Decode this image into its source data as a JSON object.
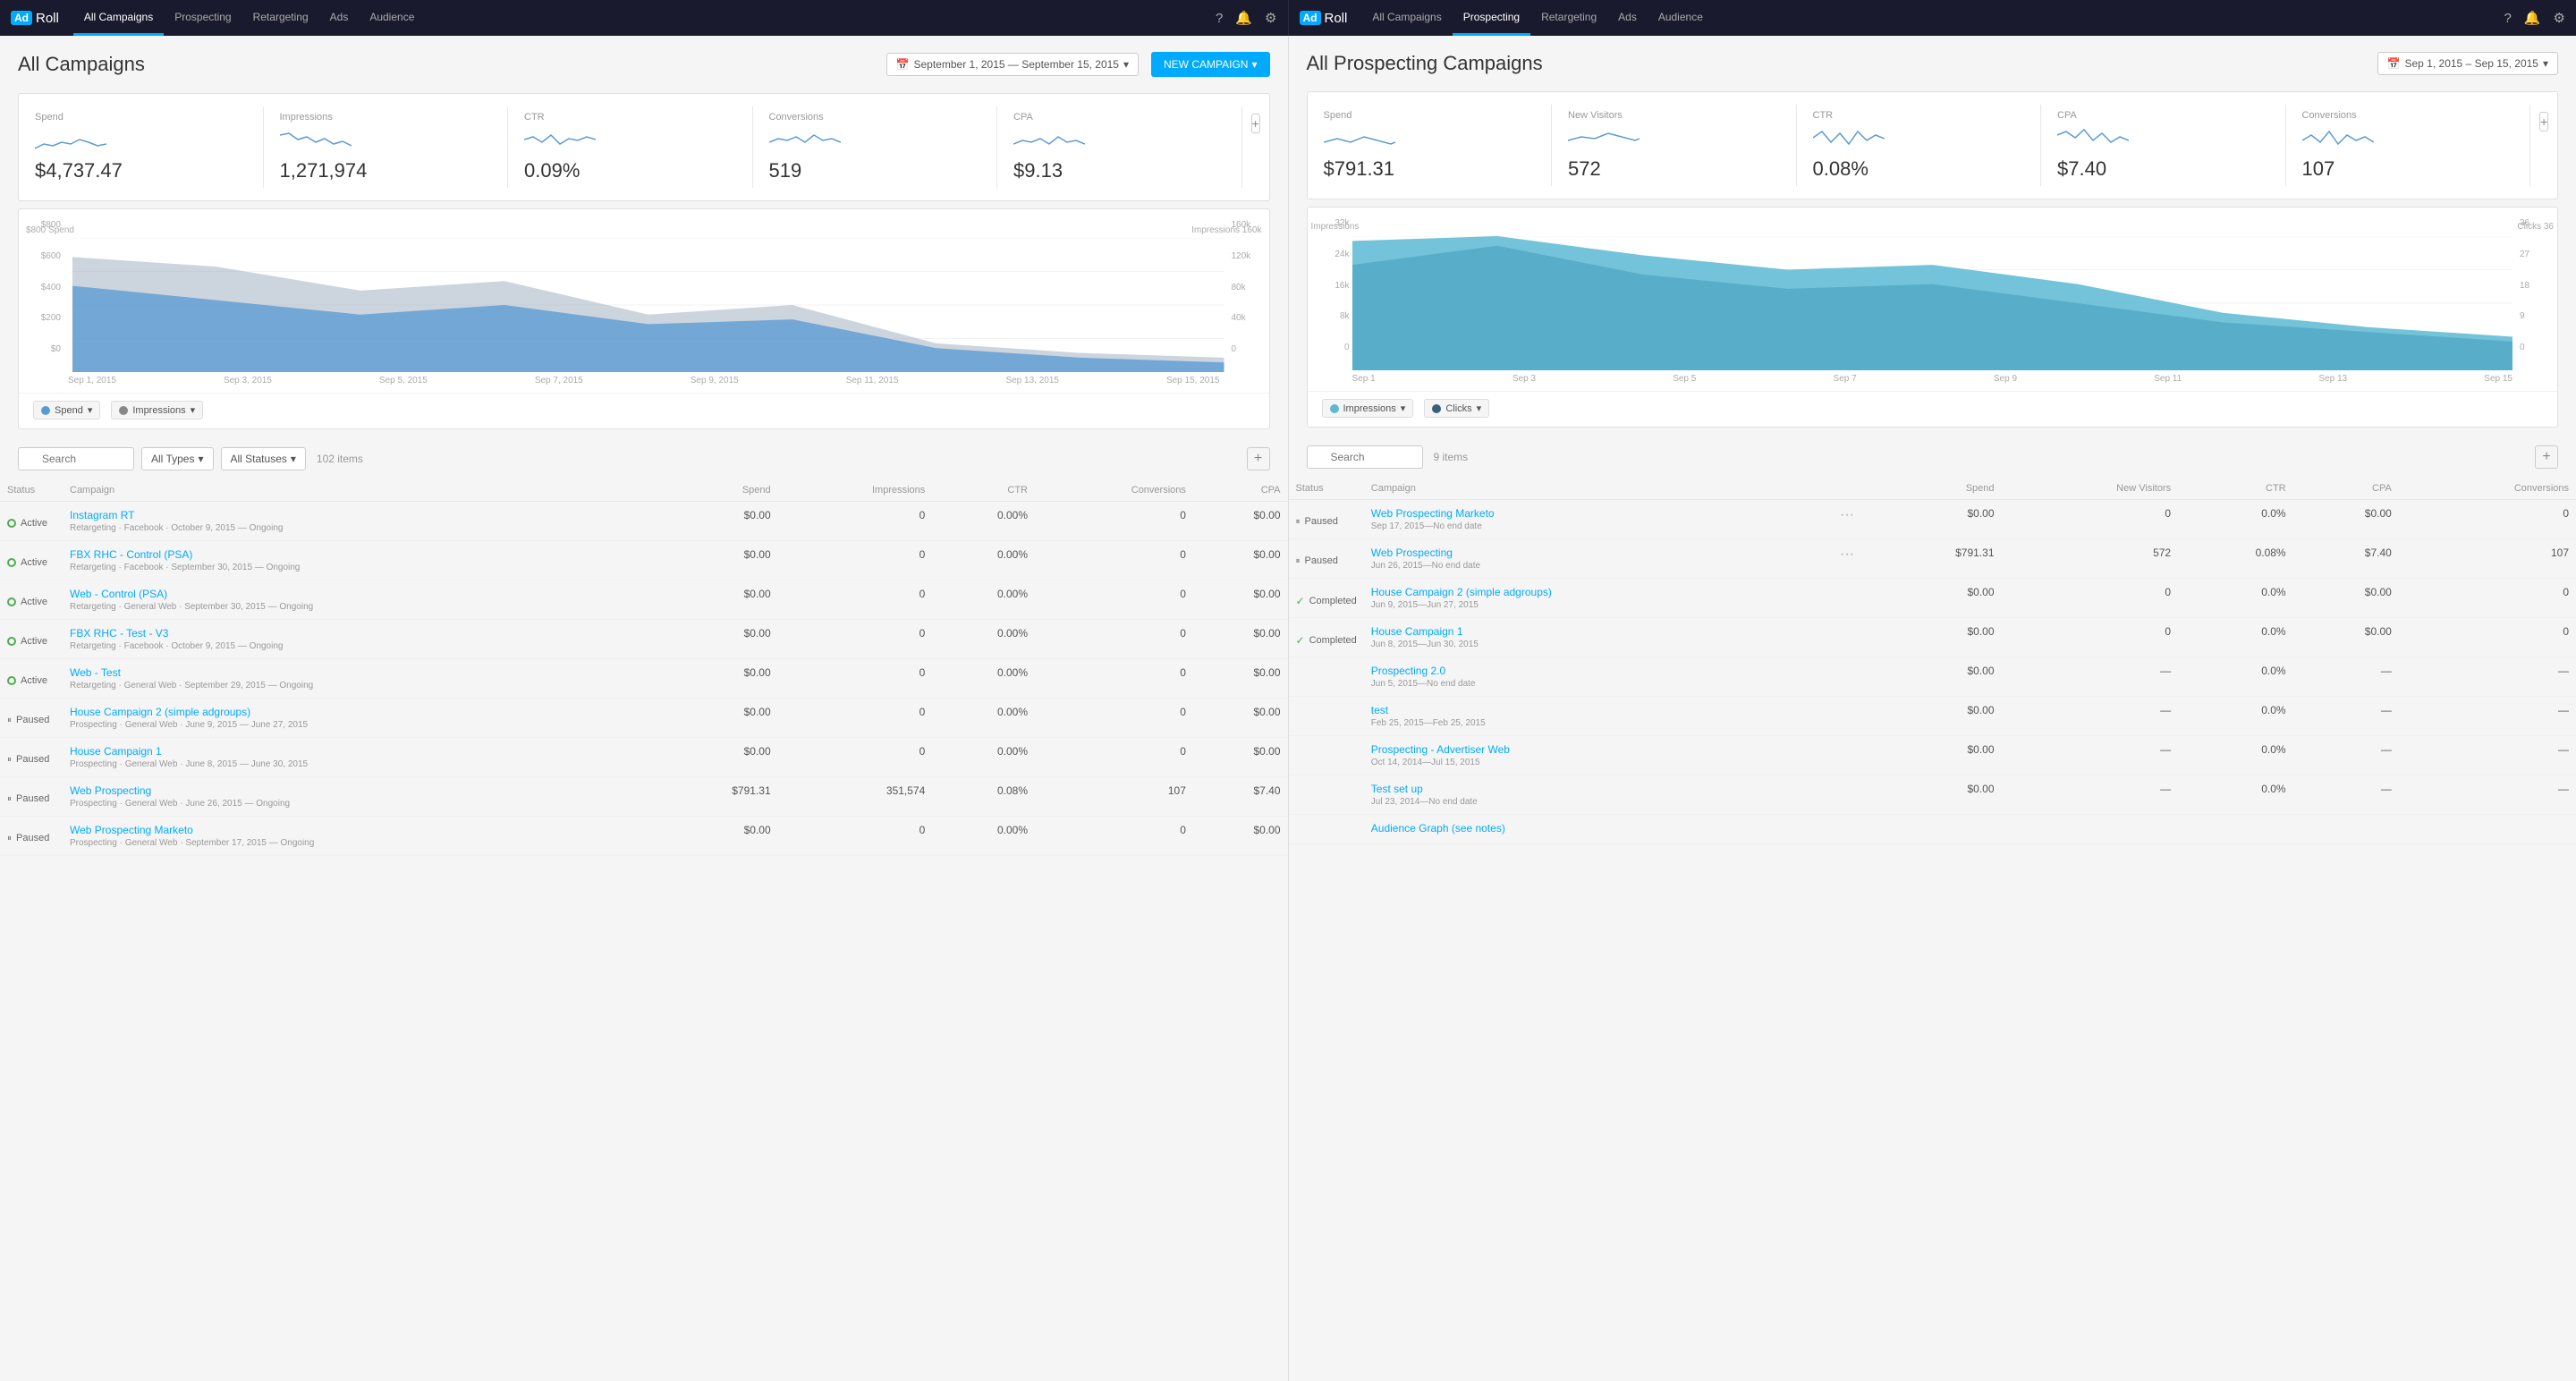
{
  "left": {
    "nav": {
      "links": [
        "All Campaigns",
        "Prospecting",
        "Retargeting",
        "Ads",
        "Audience"
      ],
      "active": "All Campaigns"
    },
    "title": "All Campaigns",
    "date_range": "September 1, 2015 — September 15, 2015",
    "new_campaign": "NEW CAMPAIGN",
    "metrics": [
      {
        "label": "Spend",
        "value": "$4,737.47"
      },
      {
        "label": "Impressions",
        "value": "1,271,974"
      },
      {
        "label": "CTR",
        "value": "0.09%"
      },
      {
        "label": "Conversions",
        "value": "519"
      },
      {
        "label": "CPA",
        "value": "$9.13"
      }
    ],
    "chart": {
      "y_left_labels": [
        "$800",
        "$600",
        "$400",
        "$200",
        "$0"
      ],
      "y_right_labels": [
        "160k",
        "120k",
        "80k",
        "40k",
        "0"
      ],
      "x_labels": [
        "Sep 1, 2015",
        "Sep 3, 2015",
        "Sep 5, 2015",
        "Sep 7, 2015",
        "Sep 9, 2015",
        "Sep 11, 2015",
        "Sep 13, 2015",
        "Sep 15, 2015"
      ],
      "y_left_label": "Spend",
      "y_right_label": "Impressions",
      "legend": [
        {
          "label": "Spend",
          "color": "#5b9bd5"
        },
        {
          "label": "Impressions",
          "color": "#555"
        }
      ]
    },
    "table": {
      "search_placeholder": "Search",
      "filter1": "All Types",
      "filter2": "All Statuses",
      "items_count": "102 items",
      "columns": [
        "Status",
        "Campaign",
        "Spend",
        "Impressions",
        "CTR",
        "Conversions",
        "CPA"
      ],
      "rows": [
        {
          "status": "Active",
          "status_type": "active",
          "name": "Instagram RT",
          "sub": "Retargeting · Facebook · October 9, 2015 — Ongoing",
          "spend": "$0.00",
          "impressions": "0",
          "ctr": "0.00%",
          "conversions": "0",
          "cpa": "$0.00"
        },
        {
          "status": "Active",
          "status_type": "active",
          "name": "FBX RHC - Control (PSA)",
          "sub": "Retargeting · Facebook · September 30, 2015 — Ongoing",
          "spend": "$0.00",
          "impressions": "0",
          "ctr": "0.00%",
          "conversions": "0",
          "cpa": "$0.00"
        },
        {
          "status": "Active",
          "status_type": "active",
          "name": "Web - Control (PSA)",
          "sub": "Retargeting · General Web · September 30, 2015 — Ongoing",
          "spend": "$0.00",
          "impressions": "0",
          "ctr": "0.00%",
          "conversions": "0",
          "cpa": "$0.00"
        },
        {
          "status": "Active",
          "status_type": "active",
          "name": "FBX RHC - Test - V3",
          "sub": "Retargeting · Facebook · October 9, 2015 — Ongoing",
          "spend": "$0.00",
          "impressions": "0",
          "ctr": "0.00%",
          "conversions": "0",
          "cpa": "$0.00"
        },
        {
          "status": "Active",
          "status_type": "active",
          "name": "Web - Test",
          "sub": "Retargeting · General Web · September 29, 2015 — Ongoing",
          "spend": "$0.00",
          "impressions": "0",
          "ctr": "0.00%",
          "conversions": "0",
          "cpa": "$0.00"
        },
        {
          "status": "Paused",
          "status_type": "paused",
          "name": "House Campaign 2 (simple adgroups)",
          "sub": "Prospecting · General Web · June 9, 2015 — June 27, 2015",
          "spend": "$0.00",
          "impressions": "0",
          "ctr": "0.00%",
          "conversions": "0",
          "cpa": "$0.00"
        },
        {
          "status": "Paused",
          "status_type": "paused",
          "name": "House Campaign 1",
          "sub": "Prospecting · General Web · June 8, 2015 — June 30, 2015",
          "spend": "$0.00",
          "impressions": "0",
          "ctr": "0.00%",
          "conversions": "0",
          "cpa": "$0.00"
        },
        {
          "status": "Paused",
          "status_type": "paused",
          "name": "Web Prospecting",
          "sub": "Prospecting · General Web · June 26, 2015 — Ongoing",
          "spend": "$791.31",
          "impressions": "351,574",
          "ctr": "0.08%",
          "conversions": "107",
          "cpa": "$7.40"
        },
        {
          "status": "Paused",
          "status_type": "paused",
          "name": "Web Prospecting Marketo",
          "sub": "Prospecting · General Web · September 17, 2015 — Ongoing",
          "spend": "$0.00",
          "impressions": "0",
          "ctr": "0.00%",
          "conversions": "0",
          "cpa": "$0.00"
        }
      ]
    }
  },
  "right": {
    "nav": {
      "links": [
        "All Campaigns",
        "Prospecting",
        "Retargeting",
        "Ads",
        "Audience"
      ],
      "active": "Prospecting"
    },
    "title": "All Prospecting Campaigns",
    "date_range": "Sep 1, 2015 – Sep 15, 2015",
    "metrics": [
      {
        "label": "Spend",
        "value": "$791.31"
      },
      {
        "label": "New Visitors",
        "value": "572"
      },
      {
        "label": "CTR",
        "value": "0.08%"
      },
      {
        "label": "CPA",
        "value": "$7.40"
      },
      {
        "label": "Conversions",
        "value": "107"
      }
    ],
    "chart": {
      "y_left_labels": [
        "32k",
        "24k",
        "16k",
        "8k",
        "0"
      ],
      "y_right_labels": [
        "36",
        "27",
        "18",
        "9",
        "0"
      ],
      "x_labels": [
        "Sep 1",
        "Sep 3",
        "Sep 5",
        "Sep 7",
        "Sep 9",
        "Sep 11",
        "Sep 13",
        "Sep 15"
      ],
      "y_left_label": "Impressions",
      "y_right_label": "Clicks",
      "legend": [
        {
          "label": "Impressions",
          "color": "#5bb8d4"
        },
        {
          "label": "Clicks",
          "color": "#3a5f7a"
        }
      ]
    },
    "table": {
      "search_placeholder": "Search",
      "items_count": "9 items",
      "columns": [
        "Status",
        "Campaign",
        "Spend",
        "New Visitors",
        "CTR",
        "CPA",
        "Conversions"
      ],
      "rows": [
        {
          "status": "Paused",
          "status_type": "paused",
          "name": "Web Prospecting Marketo",
          "sub": "Sep 17, 2015—No end date",
          "spend": "$0.00",
          "new_visitors": "0",
          "ctr": "0.0%",
          "cpa": "$0.00",
          "conversions": "0",
          "has_dots": true
        },
        {
          "status": "Paused",
          "status_type": "paused",
          "name": "Web Prospecting",
          "sub": "Jun 26, 2015—No end date",
          "spend": "$791.31",
          "new_visitors": "572",
          "ctr": "0.08%",
          "cpa": "$7.40",
          "conversions": "107",
          "has_dots": true
        },
        {
          "status": "Completed",
          "status_type": "completed",
          "name": "House Campaign 2 (simple adgroups)",
          "sub": "Jun 9, 2015—Jun 27, 2015",
          "spend": "$0.00",
          "new_visitors": "0",
          "ctr": "0.0%",
          "cpa": "$0.00",
          "conversions": "0",
          "has_dots": false
        },
        {
          "status": "Completed",
          "status_type": "completed",
          "name": "House Campaign 1",
          "sub": "Jun 8, 2015—Jun 30, 2015",
          "spend": "$0.00",
          "new_visitors": "0",
          "ctr": "0.0%",
          "cpa": "$0.00",
          "conversions": "0",
          "has_dots": false
        },
        {
          "status": "",
          "status_type": "none",
          "name": "Prospecting 2.0",
          "sub": "Jun 5, 2015—No end date",
          "spend": "$0.00",
          "new_visitors": "—",
          "ctr": "0.0%",
          "cpa": "—",
          "conversions": "—",
          "has_dots": false
        },
        {
          "status": "",
          "status_type": "none",
          "name": "test",
          "sub": "Feb 25, 2015—Feb 25, 2015",
          "spend": "$0.00",
          "new_visitors": "—",
          "ctr": "0.0%",
          "cpa": "—",
          "conversions": "—",
          "has_dots": false
        },
        {
          "status": "",
          "status_type": "none",
          "name": "Prospecting - Advertiser Web",
          "sub": "Oct 14, 2014—Jul 15, 2015",
          "spend": "$0.00",
          "new_visitors": "—",
          "ctr": "0.0%",
          "cpa": "—",
          "conversions": "—",
          "has_dots": false
        },
        {
          "status": "",
          "status_type": "none",
          "name": "Test set up",
          "sub": "Jul 23, 2014—No end date",
          "spend": "$0.00",
          "new_visitors": "—",
          "ctr": "0.0%",
          "cpa": "—",
          "conversions": "—",
          "has_dots": false
        },
        {
          "status": "",
          "status_type": "none",
          "name": "Audience Graph (see notes)",
          "sub": "",
          "spend": "",
          "new_visitors": "",
          "ctr": "",
          "cpa": "",
          "conversions": "",
          "has_dots": false
        }
      ]
    }
  }
}
